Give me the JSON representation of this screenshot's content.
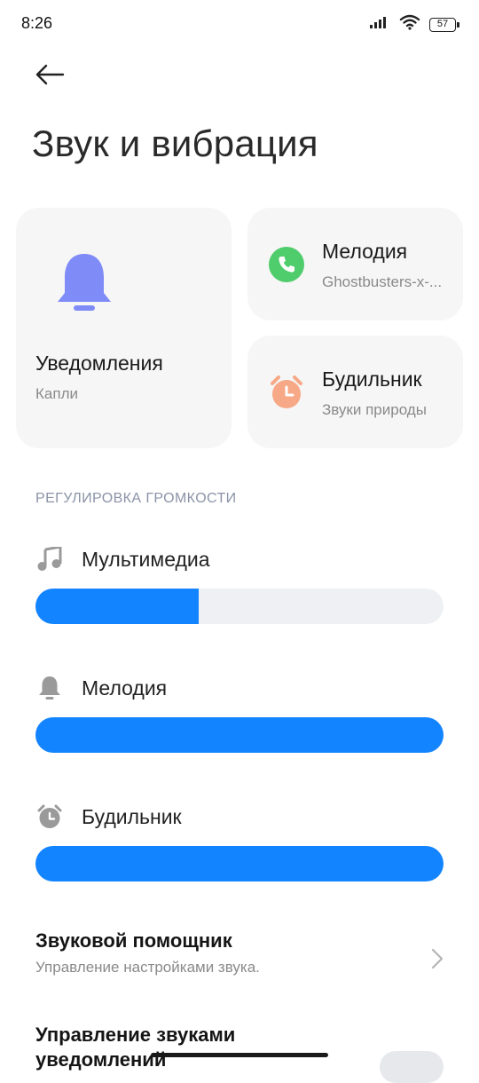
{
  "status_bar": {
    "time": "8:26",
    "battery": "57"
  },
  "header": {
    "title": "Звук и вибрация"
  },
  "cards": {
    "notifications": {
      "title": "Уведомления",
      "subtitle": "Капли",
      "icon": "bell-icon",
      "color": "#7f8bf6"
    },
    "ringtone": {
      "title": "Мелодия",
      "subtitle": "Ghostbusters-x-...",
      "icon": "phone-icon",
      "color": "#4fcc6b"
    },
    "alarm": {
      "title": "Будильник",
      "subtitle": "Звуки природы",
      "icon": "alarm-clock-icon",
      "color": "#f7a886"
    }
  },
  "volume": {
    "section_title": "РЕГУЛИРОВКА ГРОМКОСТИ",
    "accent_color": "#1384ff",
    "items": [
      {
        "label": "Мультимедиа",
        "icon": "music-note-icon",
        "level": 0.4
      },
      {
        "label": "Мелодия",
        "icon": "bell-icon",
        "level": 1.0
      },
      {
        "label": "Будильник",
        "icon": "alarm-clock-icon",
        "level": 1.0
      }
    ]
  },
  "list": {
    "sound_assistant": {
      "title": "Звуковой помощник",
      "subtitle": "Управление настройками звука."
    },
    "notification_sounds": {
      "title": "Управление звуками уведомлений"
    }
  }
}
